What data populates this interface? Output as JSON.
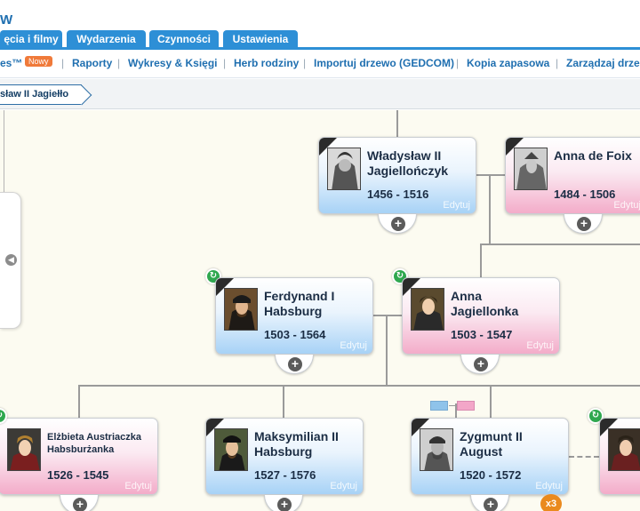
{
  "app": {
    "title": "W"
  },
  "tabs": [
    {
      "label": "ęcia i filmy"
    },
    {
      "label": "Wydarzenia"
    },
    {
      "label": "Czynności"
    },
    {
      "label": "Ustawienia"
    }
  ],
  "subnav": {
    "first_partial": "es™",
    "new_badge": "Nowy",
    "items": [
      "Raporty",
      "Wykresy & Księgi",
      "Herb rodziny",
      "Importuj drzewo (GEDCOM)",
      "Kopia zapasowa",
      "Zarządzaj drze"
    ],
    "separator": "|"
  },
  "breadcrumb": {
    "label": "sław II Jagiełło"
  },
  "people": [
    {
      "name": "Władysław II Jagiellończyk",
      "dates": "1456 - 1516",
      "gender": "male"
    },
    {
      "name": "Anna de Foix",
      "dates": "1484 - 1506",
      "gender": "female"
    },
    {
      "name": "Ferdynand I Habsburg",
      "dates": "1503 - 1564",
      "gender": "male"
    },
    {
      "name": "Anna Jagiellonka",
      "dates": "1503 - 1547",
      "gender": "female"
    },
    {
      "name": "Elżbieta Austriaczka Habsburżanka",
      "dates": "1526 - 1545",
      "gender": "female"
    },
    {
      "name": "Maksymilian II Habsburg",
      "dates": "1527 - 1576",
      "gender": "male"
    },
    {
      "name": "Zygmunt II August",
      "dates": "1520 - 1572",
      "gender": "male"
    }
  ],
  "edit_label": "Edytuj",
  "plus_label": "+",
  "spouse_count": "x3",
  "colors": {
    "tab_blue": "#2d8fd6",
    "link_blue": "#1f6fb0",
    "male_card": "#a7d2f6",
    "female_card": "#f3acc9",
    "badge_orange": "#f07a3a"
  }
}
